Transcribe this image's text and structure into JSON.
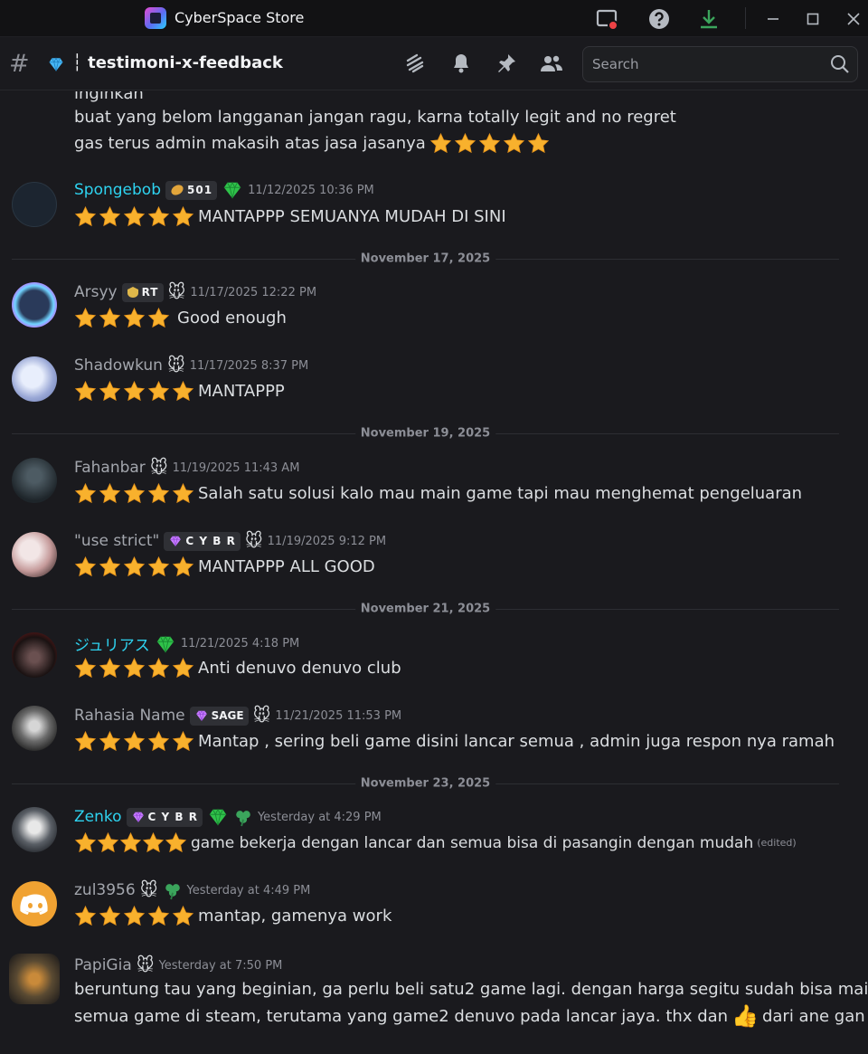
{
  "app": {
    "title": "CyberSpace Store"
  },
  "channel": {
    "name": "┆ testimoni-x-feedback"
  },
  "search": {
    "placeholder": "Search"
  },
  "continuation": {
    "line1": "inginkan",
    "line2": "buat yang belom langganan jangan ragu, karna totally legit and no regret",
    "line3": "gas terus admin makasih atas jasa jasanya"
  },
  "dividers": [
    "November 17, 2025",
    "November 19, 2025",
    "November 21, 2025",
    "November 23, 2025"
  ],
  "messages": [
    {
      "user": "Spongebob",
      "tag": "501",
      "timestamp": "11/12/2025 10:36 PM",
      "stars": 5,
      "text": "MANTAPPP SEMUANYA MUDAH DI SINI"
    },
    {
      "user": "Arsyy",
      "tag": "RT",
      "timestamp": "11/17/2025 12:22 PM",
      "stars": 4,
      "text": "Good enough"
    },
    {
      "user": "Shadowkun",
      "timestamp": "11/17/2025 8:37 PM",
      "stars": 5,
      "text": "MANTAPPP"
    },
    {
      "user": "Fahanbar",
      "timestamp": "11/19/2025 11:43 AM",
      "stars": 5,
      "text": "Salah satu solusi kalo mau main game tapi mau menghemat pengeluaran"
    },
    {
      "user": "\"use strict\"",
      "tag": "C Y B R",
      "timestamp": "11/19/2025 9:12 PM",
      "stars": 5,
      "text": "MANTAPPP ALL GOOD"
    },
    {
      "user": "ジュリアス",
      "timestamp": "11/21/2025 4:18 PM",
      "stars": 5,
      "text": "Anti denuvo denuvo club"
    },
    {
      "user": "Rahasia Name",
      "tag": "SAGE",
      "timestamp": "11/21/2025 11:53 PM",
      "stars": 5,
      "text": "Mantap , sering beli game disini lancar semua , admin juga respon nya ramah"
    },
    {
      "user": "Zenko",
      "tag": "C Y B R",
      "timestamp": "Yesterday at 4:29 PM",
      "stars": 5,
      "text": "game bekerja dengan lancar dan semua bisa di pasangin dengan mudah",
      "edited": "(edited)"
    },
    {
      "user": "zul3956",
      "timestamp": "Yesterday at 4:49 PM",
      "stars": 5,
      "text": "mantap, gamenya work"
    },
    {
      "user": "PapiGia",
      "timestamp": "Yesterday at 7:50 PM",
      "line1": "beruntung tau yang beginian, ga perlu beli satu2 game lagi. dengan harga segitu sudah bisa main",
      "line2a": "semua game di steam, terutama yang game2 denuvo pada lancar jaya. thx dan",
      "line2b": "dari ane gan"
    }
  ],
  "colors": {
    "background": "#1a1a1e",
    "name_cyan": "#2ed3f0",
    "name_gray": "#a3a6ad",
    "star": "#f8b12d",
    "gem": "#2fc24a",
    "download": "#3ba55c"
  }
}
